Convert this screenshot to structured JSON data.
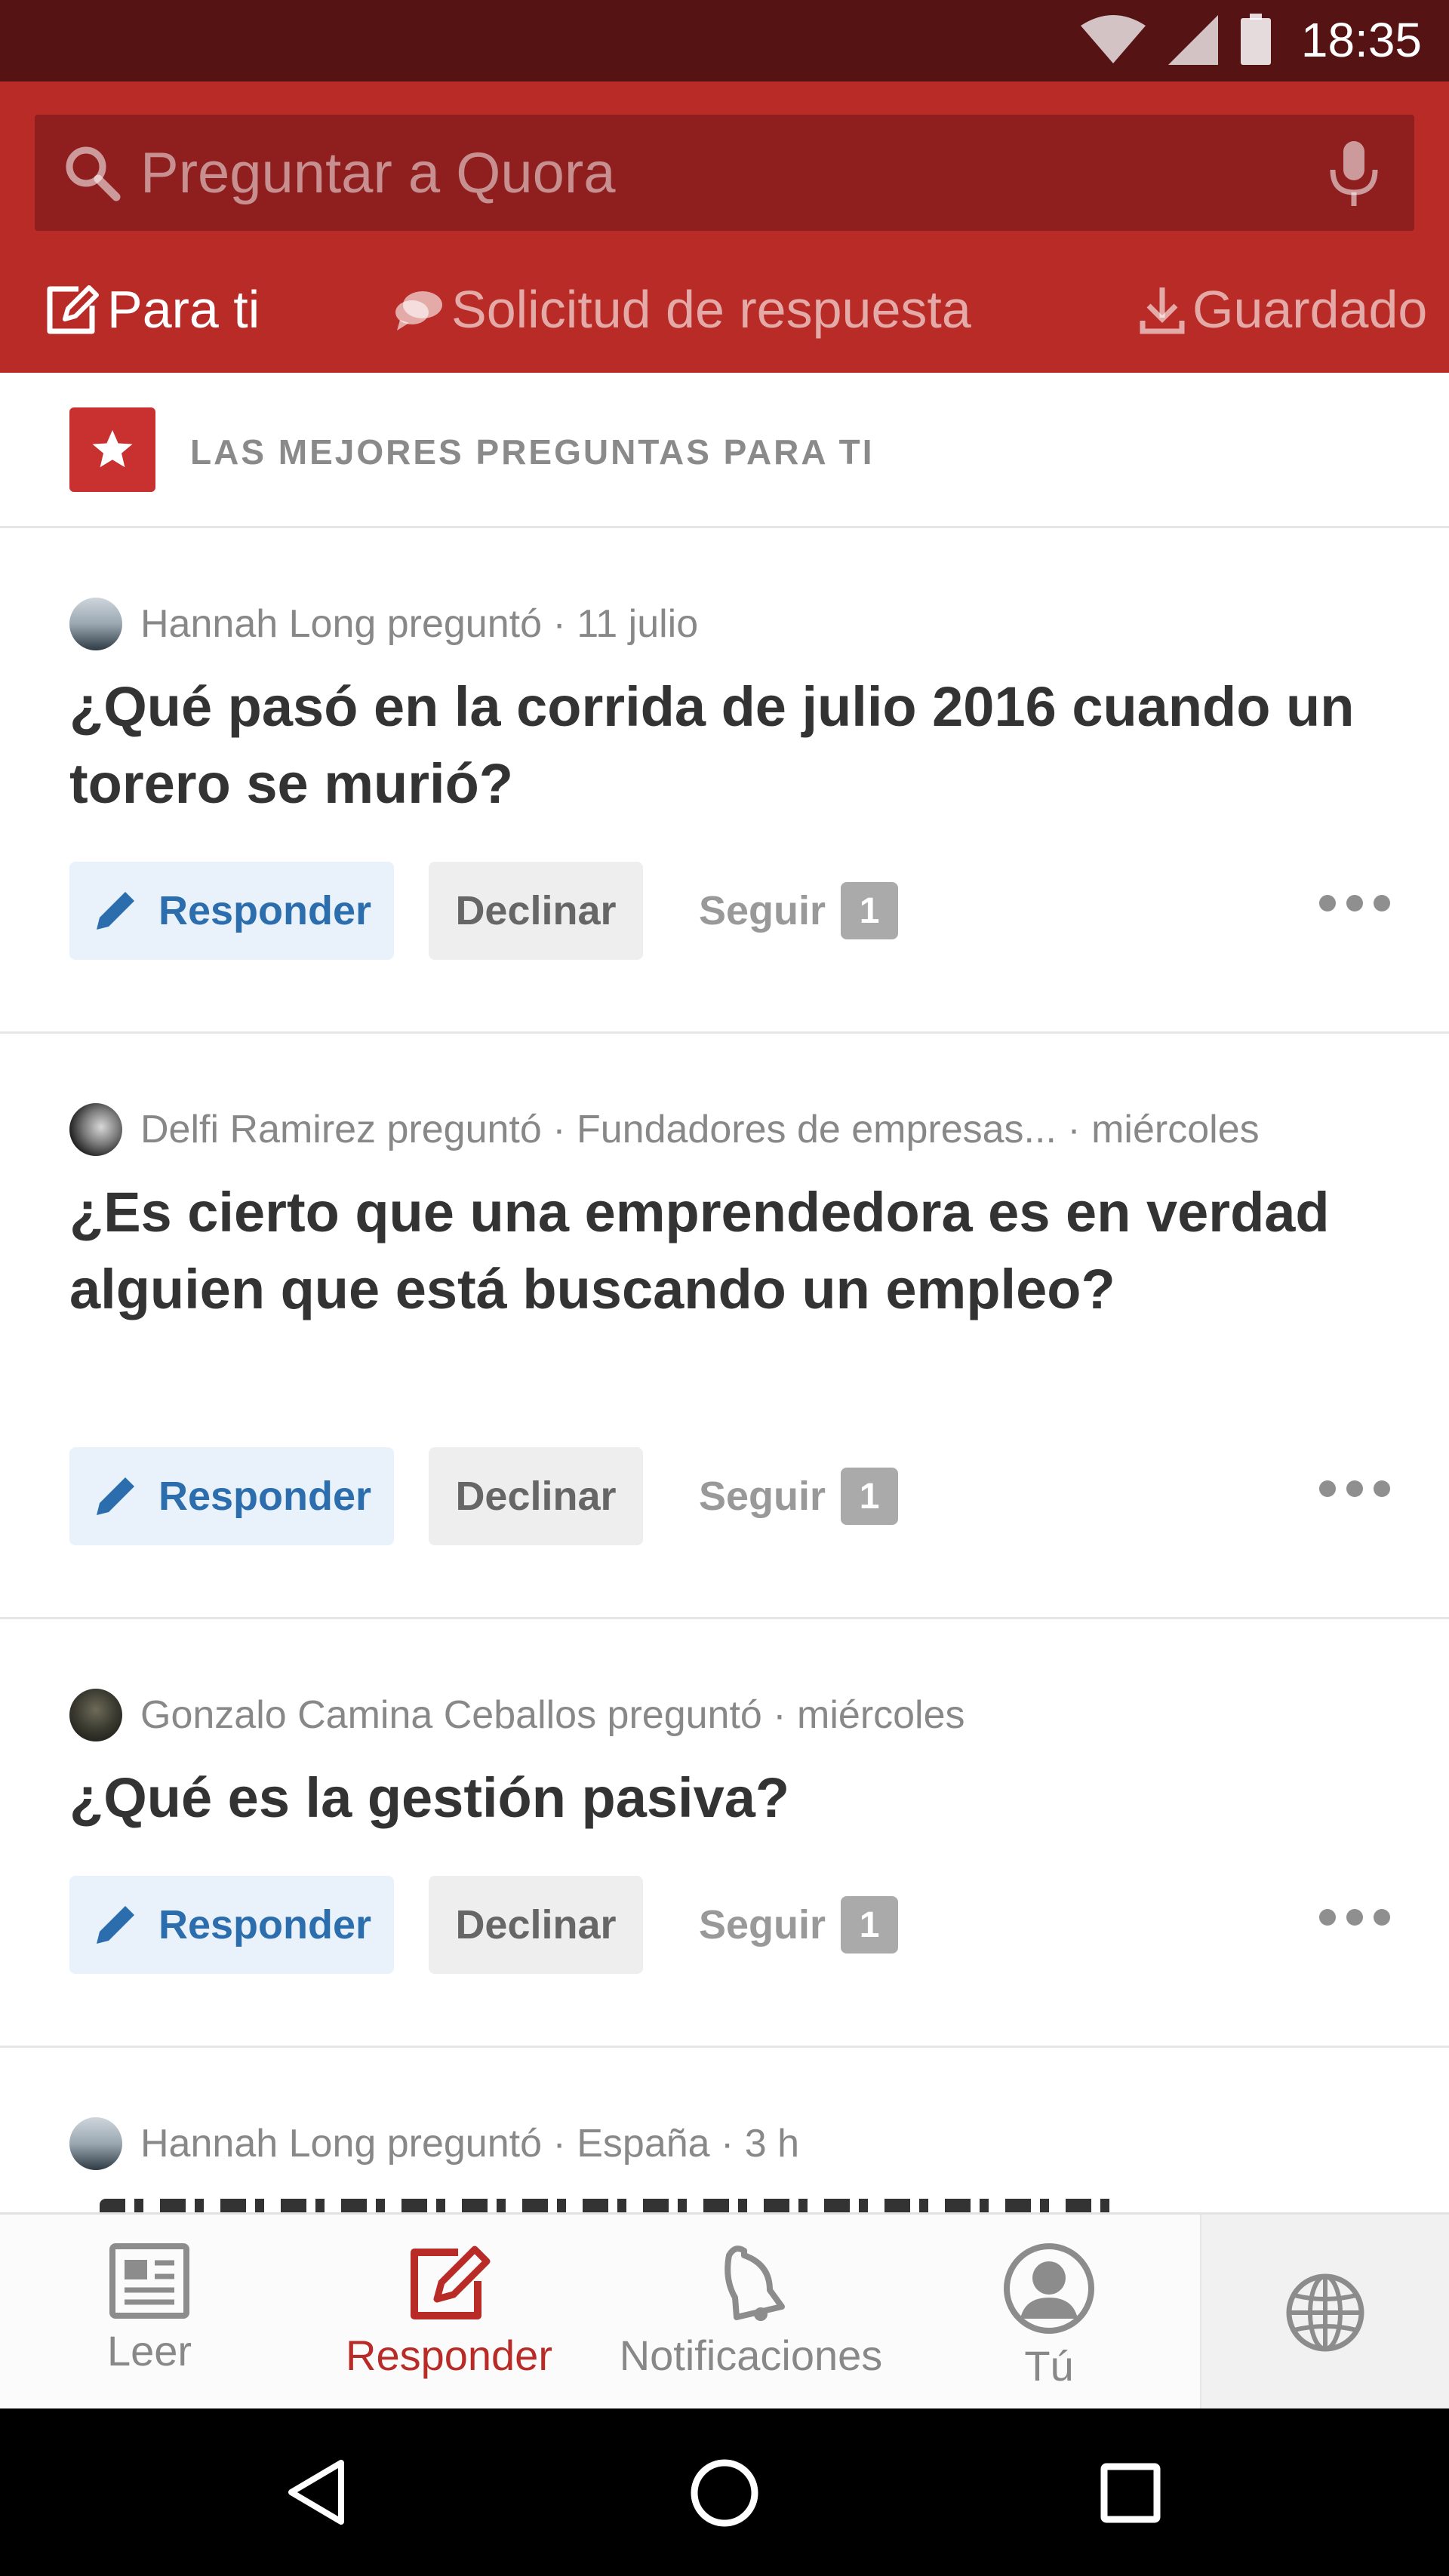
{
  "status_bar": {
    "time": "18:35"
  },
  "search": {
    "placeholder": "Preguntar a Quora"
  },
  "tabs": [
    {
      "label": "Para ti",
      "icon": "edit-icon",
      "active": true
    },
    {
      "label": "Solicitud de respuesta",
      "icon": "chat-bubbles-icon",
      "active": false
    },
    {
      "label": "Guardado",
      "icon": "download-icon",
      "active": false
    }
  ],
  "section": {
    "title": "LAS MEJORES PREGUNTAS PARA TI",
    "icon": "star-icon"
  },
  "questions": [
    {
      "meta": "Hannah Long preguntó · 11 julio",
      "title": "¿Qué pasó en la corrida de julio 2016 cuando un torero se murió?",
      "answer_label": "Responder",
      "decline_label": "Declinar",
      "follow_label": "Seguir",
      "follow_count": "1"
    },
    {
      "meta": "Delfi Ramirez preguntó · Fundadores de empresas... · miércoles",
      "title": "¿Es cierto que una emprendedora es en verdad alguien que está buscando un empleo?",
      "answer_label": "Responder",
      "decline_label": "Declinar",
      "follow_label": "Seguir",
      "follow_count": "1"
    },
    {
      "meta": "Gonzalo Camina Ceballos preguntó · miércoles",
      "title": "¿Qué es la gestión pasiva?",
      "answer_label": "Responder",
      "decline_label": "Declinar",
      "follow_label": "Seguir",
      "follow_count": "1"
    },
    {
      "meta": "Hannah Long preguntó · España · 3 h"
    }
  ],
  "bottom_nav": [
    {
      "label": "Leer",
      "icon": "newspaper-icon",
      "active": false
    },
    {
      "label": "Responder",
      "icon": "edit-icon",
      "active": true
    },
    {
      "label": "Notificaciones",
      "icon": "bell-icon",
      "active": false
    },
    {
      "label": "Tú",
      "icon": "profile-icon",
      "active": false
    },
    {
      "label": "",
      "icon": "globe-icon",
      "active": false
    }
  ],
  "colors": {
    "brand": "#b92b27",
    "status_bar": "#551314",
    "search_bg": "#8f1f1f",
    "answer_blue": "#2b6dad"
  }
}
